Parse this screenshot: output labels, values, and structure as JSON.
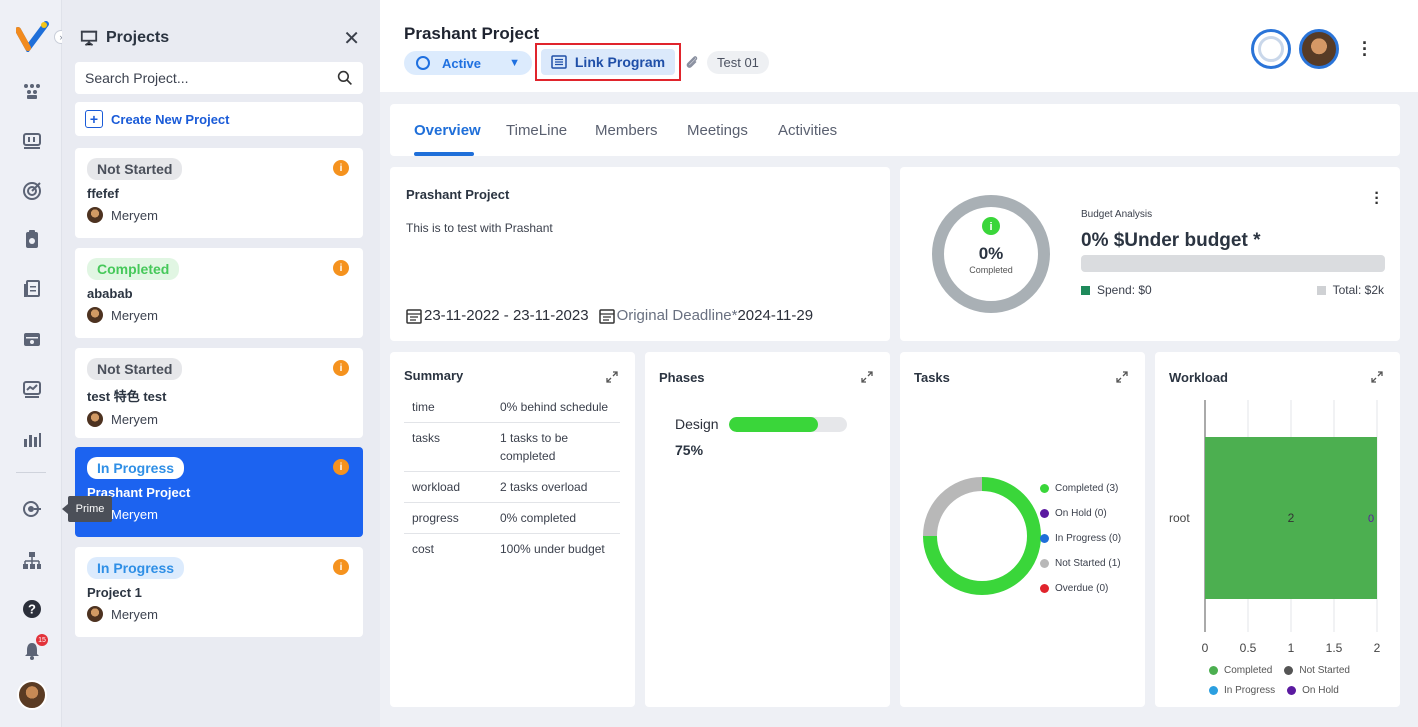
{
  "rail": {
    "tooltip": "Prime",
    "notification_count": "15",
    "icons": [
      "app-logo",
      "team-icon",
      "board-icon",
      "target-icon",
      "clipboard-icon",
      "documents-icon",
      "meeting-icon",
      "trend-icon",
      "bar-chart-icon",
      "prime-icon",
      "hierarchy-icon",
      "help-icon",
      "bell-icon"
    ]
  },
  "projects_panel": {
    "title": "Projects",
    "search_placeholder": "Search Project...",
    "create_label": "Create New Project",
    "cards": [
      {
        "status": "Not Started",
        "name": "ffefef",
        "owner": "Meryem"
      },
      {
        "status": "Completed",
        "name": "ababab",
        "owner": "Meryem"
      },
      {
        "status": "Not Started",
        "name": "test 特色 test",
        "owner": "Meryem"
      },
      {
        "status": "In Progress",
        "name": "Prashant Project",
        "owner": "Meryem",
        "selected": true
      },
      {
        "status": "In Progress",
        "name": "Project 1",
        "owner": "Meryem"
      }
    ]
  },
  "header": {
    "title": "Prashant Project",
    "status": "Active",
    "link_program": "Link Program",
    "tag": "Test 01"
  },
  "tabs": [
    "Overview",
    "TimeLine",
    "Members",
    "Meetings",
    "Activities"
  ],
  "description": {
    "title": "Prashant Project",
    "text": "This is to test with Prashant",
    "date_range": "23-11-2022 - 23-11-2023",
    "original_deadline_label": "Original Deadline*",
    "original_deadline": "2024-11-29"
  },
  "budget": {
    "donut_pct": "0%",
    "donut_label": "Completed",
    "analysis_label": "Budget Analysis",
    "headline": "0% $Under budget *",
    "spend": "Spend: $0",
    "total": "Total: $2k",
    "spend_fraction": 0
  },
  "summary": {
    "title": "Summary",
    "rows": [
      {
        "k": "time",
        "v": "0% behind schedule"
      },
      {
        "k": "tasks",
        "v": "1 tasks to be completed"
      },
      {
        "k": "workload",
        "v": "2 tasks overload"
      },
      {
        "k": "progress",
        "v": "0% completed"
      },
      {
        "k": "cost",
        "v": "100% under budget"
      }
    ]
  },
  "phases": {
    "title": "Phases",
    "items": [
      {
        "name": "Design",
        "pct_label": "75%",
        "value": 0.75
      }
    ]
  },
  "tasks": {
    "title": "Tasks",
    "legend": [
      "Completed (3)",
      "On Hold (0)",
      "In Progress (0)",
      "Not Started (1)",
      "Overdue (0)"
    ]
  },
  "workload": {
    "title": "Workload",
    "row_label": "root",
    "bar_label": "2",
    "zero_label": "0",
    "legend": [
      "Completed",
      "Not Started",
      "In Progress",
      "On Hold"
    ]
  },
  "colors": {
    "accent": "#1c63f0",
    "completed": "#3ad63a",
    "on_hold": "#5b1aa0",
    "in_progress": "#1f6fd9",
    "not_started": "#b8b8b8",
    "overdue": "#e0242c",
    "workload_bar": "#4caf50"
  },
  "chart_data": [
    {
      "type": "pie",
      "title": "",
      "categories": [
        "Completed",
        "On Hold",
        "In Progress",
        "Not Started",
        "Overdue"
      ],
      "values": [
        3,
        0,
        0,
        1,
        0
      ]
    },
    {
      "type": "bar",
      "title": "",
      "orientation": "horizontal",
      "categories": [
        "root"
      ],
      "series": [
        {
          "name": "Completed",
          "values": [
            2
          ]
        },
        {
          "name": "Not Started",
          "values": [
            0
          ]
        },
        {
          "name": "In Progress",
          "values": [
            0
          ]
        },
        {
          "name": "On Hold",
          "values": [
            0
          ]
        }
      ],
      "xlim": [
        0,
        2
      ],
      "xticks": [
        "0",
        "0.5",
        "1",
        "1.5",
        "2"
      ]
    }
  ]
}
